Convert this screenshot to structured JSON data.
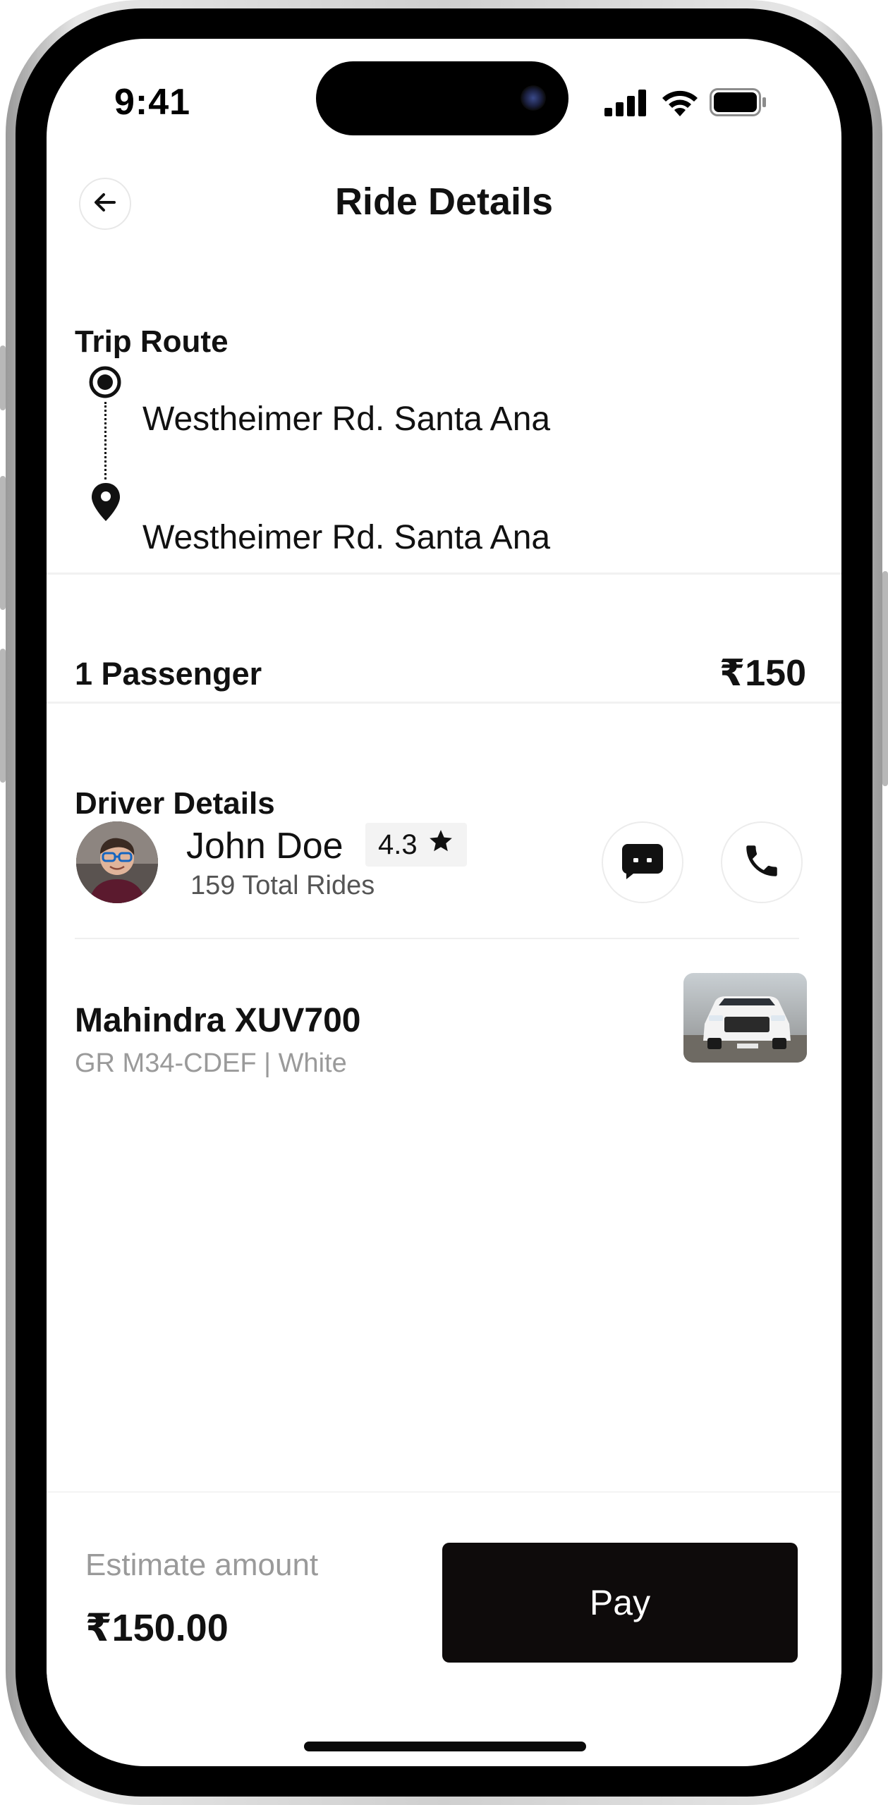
{
  "status_bar": {
    "time": "9:41"
  },
  "header": {
    "title": "Ride Details",
    "back_icon": "arrow-left-icon"
  },
  "trip_route": {
    "label": "Trip Route",
    "pickup": "Westheimer Rd. Santa Ana",
    "dropoff": "Westheimer Rd. Santa Ana"
  },
  "fare": {
    "passengers": "1 Passenger",
    "price": "₹150"
  },
  "driver": {
    "section_label": "Driver Details",
    "name": "John Doe",
    "rating": "4.3",
    "total_rides": "159 Total Rides"
  },
  "vehicle": {
    "model": "Mahindra XUV700",
    "details": "GR M34-CDEF | White"
  },
  "footer": {
    "estimate_label": "Estimate amount",
    "estimate_amount": "₹150.00",
    "pay_label": "Pay"
  }
}
